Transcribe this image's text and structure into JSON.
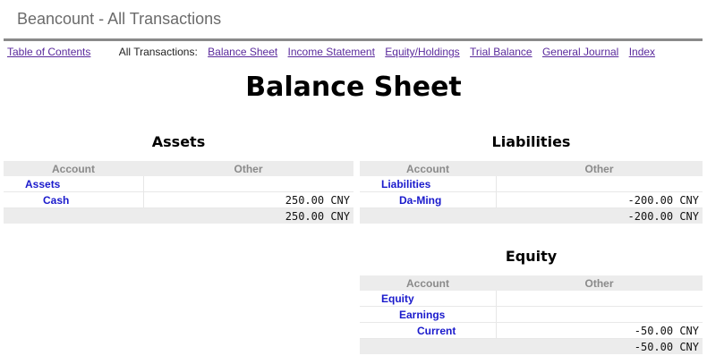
{
  "window": {
    "title": "Beancount - All Transactions"
  },
  "nav": {
    "toc": "Table of Contents",
    "prefix": "All Transactions:",
    "links": [
      "Balance Sheet",
      "Income Statement",
      "Equity/Holdings",
      "Trial Balance",
      "General Journal",
      "Index"
    ]
  },
  "page": {
    "heading": "Balance Sheet"
  },
  "table_headers": {
    "account": "Account",
    "other": "Other"
  },
  "assets": {
    "title": "Assets",
    "root": "Assets",
    "rows": [
      {
        "account": "Cash",
        "amount": "250.00 CNY"
      }
    ],
    "total": "250.00 CNY"
  },
  "liabilities": {
    "title": "Liabilities",
    "root": "Liabilities",
    "rows": [
      {
        "account": "Da-Ming",
        "amount": "-200.00 CNY"
      }
    ],
    "total": "-200.00 CNY"
  },
  "equity": {
    "title": "Equity",
    "root": "Equity",
    "child": "Earnings",
    "rows": [
      {
        "account": "Current",
        "amount": "-50.00 CNY"
      }
    ],
    "total": "-50.00 CNY"
  },
  "colors": {
    "link": "#5a2a9c",
    "account": "#1a1acc",
    "header_bg": "#ececec",
    "rule": "#8a8a8a"
  }
}
